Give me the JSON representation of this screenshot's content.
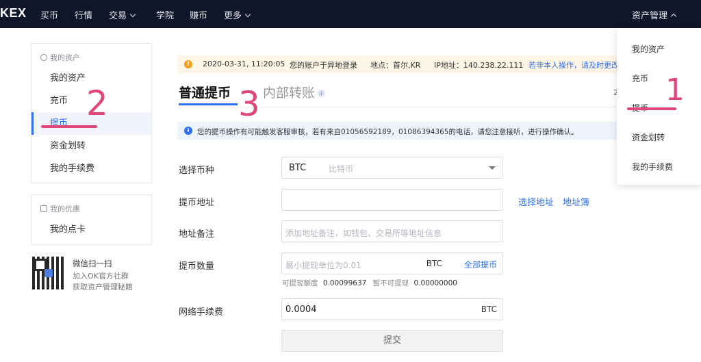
{
  "nav": {
    "logo": "KEX",
    "items": [
      {
        "label": "买币",
        "caret": false
      },
      {
        "label": "行情",
        "caret": false
      },
      {
        "label": "交易",
        "caret": true
      },
      {
        "label": "学院",
        "caret": false
      },
      {
        "label": "赚币",
        "caret": false
      },
      {
        "label": "更多",
        "caret": true
      }
    ],
    "asset_menu": "资产管理"
  },
  "sidebar": {
    "assets_header": "我的资产",
    "assets_items": [
      "我的资产",
      "充币",
      "提币",
      "资金划转",
      "我的手续费"
    ],
    "active_item": "提币",
    "promo_header": "我的优惠",
    "promo_items": [
      "我的点卡"
    ],
    "qr": {
      "title": "微信扫一扫",
      "line1": "加入OK官方社群",
      "line2": "获取资产管理秘籍"
    }
  },
  "alert": {
    "time": "2020-03-31, 11:20:05",
    "message": "您的账户于异地登录",
    "location": "地点：首尔,KR",
    "ip": "IP地址：140.238.22.111",
    "action": "若非本人操作，请及时更改"
  },
  "tabs": {
    "active": "普通提币",
    "inactive": "内部转账",
    "info_glyph": "i",
    "right_text": "2"
  },
  "notice": {
    "text": "您的提币操作有可能触发客服审核，若有来自01056592189，01086394365的电话，请您注意接听，进行操作确认。"
  },
  "form": {
    "coin_label": "选择币种",
    "coin_value": "BTC",
    "coin_name": "比特币",
    "address_label": "提币地址",
    "address_value": "",
    "address_links": [
      "选择地址",
      "地址簿"
    ],
    "memo_label": "地址备注",
    "memo_placeholder": "添加地址备注，如钱包、交易所等地址信息",
    "amount_label": "提币数量",
    "amount_placeholder": "最小提现单位为0.01",
    "amount_unit": "BTC",
    "amount_all": "全部提币",
    "available_label": "可提现额度",
    "available_value": "0.00099637",
    "unavailable_label": "暂不可提现",
    "unavailable_value": "0.00000000",
    "fee_label": "网络手续费",
    "fee_value": "0.0004",
    "fee_unit": "BTC",
    "submit_label": "提交"
  },
  "dropdown": {
    "items": [
      "我的资产",
      "充币",
      "提币",
      "资金划转",
      "我的手续费"
    ]
  },
  "annotations": [
    "1",
    "2",
    "3"
  ],
  "colors": {
    "nav_bg": "#0e1629",
    "accent": "#2f6ef7",
    "annotation": "#e0467a",
    "warning": "#f0a020"
  }
}
